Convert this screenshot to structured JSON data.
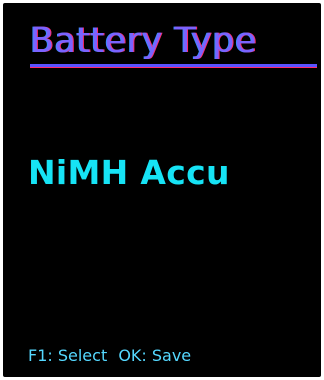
{
  "screen": {
    "title": "Battery Type",
    "value": "NiMH Accu",
    "hint_select": "F1: Select",
    "hint_save": "OK: Save"
  },
  "colors": {
    "background": "#000000",
    "title": "#7a63ff",
    "underline": "#5a52ff",
    "value": "#16e3f5",
    "hint": "#55d8ff"
  }
}
